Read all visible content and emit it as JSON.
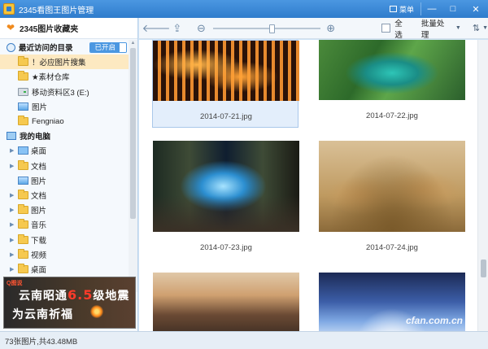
{
  "window": {
    "title": "2345看图王图片管理",
    "menu_label": "菜单",
    "minimize": "—",
    "maximize": "□",
    "close": "✕"
  },
  "sidebar": {
    "favorites_title": "2345图片收藏夹",
    "recent_section": "最近访问的目录",
    "recent_toggle": "已开启",
    "recent_items": [
      {
        "label": "！必应图片搜集",
        "icon": "folder-icon",
        "selected": true
      },
      {
        "label": "★素材仓库",
        "icon": "folder-icon"
      },
      {
        "label": "移动资料区3 (E:)",
        "icon": "drive-icon"
      },
      {
        "label": "图片",
        "icon": "image-icon"
      },
      {
        "label": "Fengniao",
        "icon": "folder-icon"
      }
    ],
    "computer_section": "我的电脑",
    "computer_items": [
      {
        "label": "桌面",
        "icon": "desktop-icon",
        "expandable": true
      },
      {
        "label": "文档",
        "icon": "folder-icon",
        "expandable": true
      },
      {
        "label": "图片",
        "icon": "image-icon",
        "expandable": false
      },
      {
        "label": "文档",
        "icon": "folder-icon",
        "expandable": true
      },
      {
        "label": "图片",
        "icon": "folder-icon",
        "expandable": true
      },
      {
        "label": "音乐",
        "icon": "folder-icon",
        "expandable": true
      },
      {
        "label": "下载",
        "icon": "folder-icon",
        "expandable": true
      },
      {
        "label": "视频",
        "icon": "folder-icon",
        "expandable": true
      },
      {
        "label": "桌面",
        "icon": "folder-icon",
        "expandable": true
      }
    ],
    "ad": {
      "logo": "Q图说",
      "line1_prefix": "云南昭通",
      "line1_magnitude": "6.5",
      "line1_suffix": "级地震",
      "line2": "为云南祈福"
    }
  },
  "toolbar": {
    "back_icon": "arrow-left-icon",
    "share_icon": "share-icon",
    "zoom_level": 0.55,
    "select_all_label": "全选",
    "batch_label": "批量处理",
    "sort_icon": "sort-icon"
  },
  "thumbnails": [
    {
      "caption": "2014-07-21.jpg",
      "scene": "lanterns",
      "selected": true
    },
    {
      "caption": "2014-07-22.jpg",
      "scene": "river",
      "selected": false
    },
    {
      "caption": "2014-07-23.jpg",
      "scene": "cave",
      "selected": false
    },
    {
      "caption": "2014-07-24.jpg",
      "scene": "meerkat",
      "selected": false
    },
    {
      "caption": "",
      "scene": "town",
      "selected": false
    },
    {
      "caption": "",
      "scene": "sky",
      "selected": false
    }
  ],
  "watermark": "cfan.com.cn",
  "status": {
    "summary": "73张图片,共43.48MB"
  },
  "colors": {
    "titlebar": "#3a8ad6",
    "accent": "#4b97e1",
    "selected_row": "#fde9c1"
  }
}
